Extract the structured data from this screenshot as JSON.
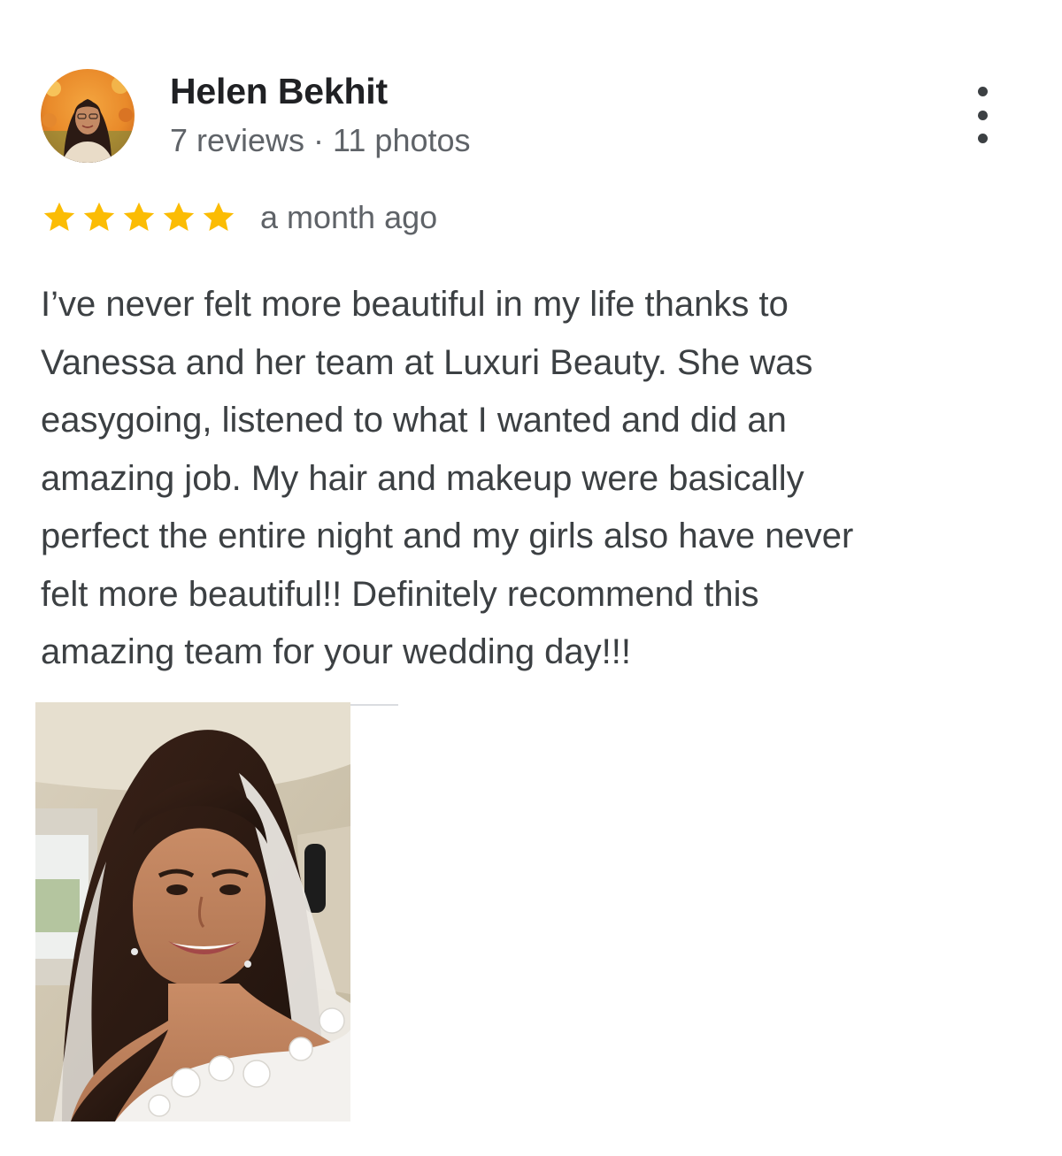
{
  "review": {
    "reviewer": {
      "name": "Helen Bekhit",
      "meta": "7 reviews · 11 photos",
      "avatar_icon": "reviewer-avatar-photo"
    },
    "menu_icon": "more-vert-icon",
    "rating": {
      "stars": 5,
      "max_stars": 5,
      "star_color": "#fbbc04",
      "date": "a month ago"
    },
    "text_lines": [
      "I’ve never felt more beautiful in my life thanks to",
      "Vanessa and her team at Luxuri Beauty. She was",
      "easygoing, listened to what I wanted and did an",
      "amazing job. My hair and makeup were basically",
      "perfect the entire night and my girls also have never",
      "felt more beautiful!! Definitely recommend this",
      "amazing team for your wedding day!!!"
    ],
    "photos": [
      {
        "icon": "bride-selfie-photo"
      }
    ]
  },
  "colors": {
    "name": "#202124",
    "body_text": "#3c4043",
    "secondary_text": "#5f6368",
    "star": "#fbbc04"
  }
}
